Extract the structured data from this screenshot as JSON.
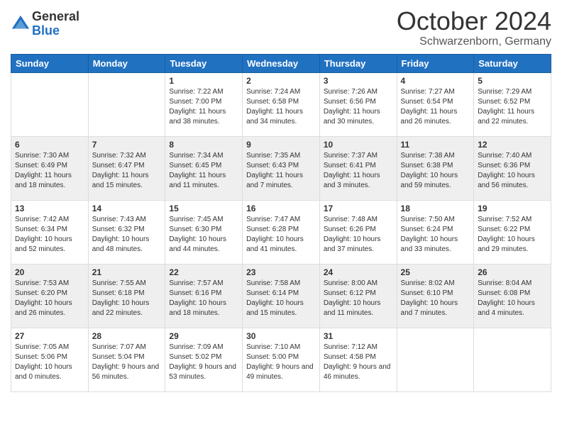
{
  "header": {
    "logo": {
      "general": "General",
      "blue": "Blue"
    },
    "title": "October 2024",
    "location": "Schwarzenborn, Germany"
  },
  "calendar": {
    "weekdays": [
      "Sunday",
      "Monday",
      "Tuesday",
      "Wednesday",
      "Thursday",
      "Friday",
      "Saturday"
    ],
    "weeks": [
      [
        {
          "day": null,
          "sunrise": null,
          "sunset": null,
          "daylight": null
        },
        {
          "day": null,
          "sunrise": null,
          "sunset": null,
          "daylight": null
        },
        {
          "day": "1",
          "sunrise": "Sunrise: 7:22 AM",
          "sunset": "Sunset: 7:00 PM",
          "daylight": "Daylight: 11 hours and 38 minutes."
        },
        {
          "day": "2",
          "sunrise": "Sunrise: 7:24 AM",
          "sunset": "Sunset: 6:58 PM",
          "daylight": "Daylight: 11 hours and 34 minutes."
        },
        {
          "day": "3",
          "sunrise": "Sunrise: 7:26 AM",
          "sunset": "Sunset: 6:56 PM",
          "daylight": "Daylight: 11 hours and 30 minutes."
        },
        {
          "day": "4",
          "sunrise": "Sunrise: 7:27 AM",
          "sunset": "Sunset: 6:54 PM",
          "daylight": "Daylight: 11 hours and 26 minutes."
        },
        {
          "day": "5",
          "sunrise": "Sunrise: 7:29 AM",
          "sunset": "Sunset: 6:52 PM",
          "daylight": "Daylight: 11 hours and 22 minutes."
        }
      ],
      [
        {
          "day": "6",
          "sunrise": "Sunrise: 7:30 AM",
          "sunset": "Sunset: 6:49 PM",
          "daylight": "Daylight: 11 hours and 18 minutes."
        },
        {
          "day": "7",
          "sunrise": "Sunrise: 7:32 AM",
          "sunset": "Sunset: 6:47 PM",
          "daylight": "Daylight: 11 hours and 15 minutes."
        },
        {
          "day": "8",
          "sunrise": "Sunrise: 7:34 AM",
          "sunset": "Sunset: 6:45 PM",
          "daylight": "Daylight: 11 hours and 11 minutes."
        },
        {
          "day": "9",
          "sunrise": "Sunrise: 7:35 AM",
          "sunset": "Sunset: 6:43 PM",
          "daylight": "Daylight: 11 hours and 7 minutes."
        },
        {
          "day": "10",
          "sunrise": "Sunrise: 7:37 AM",
          "sunset": "Sunset: 6:41 PM",
          "daylight": "Daylight: 11 hours and 3 minutes."
        },
        {
          "day": "11",
          "sunrise": "Sunrise: 7:38 AM",
          "sunset": "Sunset: 6:38 PM",
          "daylight": "Daylight: 10 hours and 59 minutes."
        },
        {
          "day": "12",
          "sunrise": "Sunrise: 7:40 AM",
          "sunset": "Sunset: 6:36 PM",
          "daylight": "Daylight: 10 hours and 56 minutes."
        }
      ],
      [
        {
          "day": "13",
          "sunrise": "Sunrise: 7:42 AM",
          "sunset": "Sunset: 6:34 PM",
          "daylight": "Daylight: 10 hours and 52 minutes."
        },
        {
          "day": "14",
          "sunrise": "Sunrise: 7:43 AM",
          "sunset": "Sunset: 6:32 PM",
          "daylight": "Daylight: 10 hours and 48 minutes."
        },
        {
          "day": "15",
          "sunrise": "Sunrise: 7:45 AM",
          "sunset": "Sunset: 6:30 PM",
          "daylight": "Daylight: 10 hours and 44 minutes."
        },
        {
          "day": "16",
          "sunrise": "Sunrise: 7:47 AM",
          "sunset": "Sunset: 6:28 PM",
          "daylight": "Daylight: 10 hours and 41 minutes."
        },
        {
          "day": "17",
          "sunrise": "Sunrise: 7:48 AM",
          "sunset": "Sunset: 6:26 PM",
          "daylight": "Daylight: 10 hours and 37 minutes."
        },
        {
          "day": "18",
          "sunrise": "Sunrise: 7:50 AM",
          "sunset": "Sunset: 6:24 PM",
          "daylight": "Daylight: 10 hours and 33 minutes."
        },
        {
          "day": "19",
          "sunrise": "Sunrise: 7:52 AM",
          "sunset": "Sunset: 6:22 PM",
          "daylight": "Daylight: 10 hours and 29 minutes."
        }
      ],
      [
        {
          "day": "20",
          "sunrise": "Sunrise: 7:53 AM",
          "sunset": "Sunset: 6:20 PM",
          "daylight": "Daylight: 10 hours and 26 minutes."
        },
        {
          "day": "21",
          "sunrise": "Sunrise: 7:55 AM",
          "sunset": "Sunset: 6:18 PM",
          "daylight": "Daylight: 10 hours and 22 minutes."
        },
        {
          "day": "22",
          "sunrise": "Sunrise: 7:57 AM",
          "sunset": "Sunset: 6:16 PM",
          "daylight": "Daylight: 10 hours and 18 minutes."
        },
        {
          "day": "23",
          "sunrise": "Sunrise: 7:58 AM",
          "sunset": "Sunset: 6:14 PM",
          "daylight": "Daylight: 10 hours and 15 minutes."
        },
        {
          "day": "24",
          "sunrise": "Sunrise: 8:00 AM",
          "sunset": "Sunset: 6:12 PM",
          "daylight": "Daylight: 10 hours and 11 minutes."
        },
        {
          "day": "25",
          "sunrise": "Sunrise: 8:02 AM",
          "sunset": "Sunset: 6:10 PM",
          "daylight": "Daylight: 10 hours and 7 minutes."
        },
        {
          "day": "26",
          "sunrise": "Sunrise: 8:04 AM",
          "sunset": "Sunset: 6:08 PM",
          "daylight": "Daylight: 10 hours and 4 minutes."
        }
      ],
      [
        {
          "day": "27",
          "sunrise": "Sunrise: 7:05 AM",
          "sunset": "Sunset: 5:06 PM",
          "daylight": "Daylight: 10 hours and 0 minutes."
        },
        {
          "day": "28",
          "sunrise": "Sunrise: 7:07 AM",
          "sunset": "Sunset: 5:04 PM",
          "daylight": "Daylight: 9 hours and 56 minutes."
        },
        {
          "day": "29",
          "sunrise": "Sunrise: 7:09 AM",
          "sunset": "Sunset: 5:02 PM",
          "daylight": "Daylight: 9 hours and 53 minutes."
        },
        {
          "day": "30",
          "sunrise": "Sunrise: 7:10 AM",
          "sunset": "Sunset: 5:00 PM",
          "daylight": "Daylight: 9 hours and 49 minutes."
        },
        {
          "day": "31",
          "sunrise": "Sunrise: 7:12 AM",
          "sunset": "Sunset: 4:58 PM",
          "daylight": "Daylight: 9 hours and 46 minutes."
        },
        {
          "day": null,
          "sunrise": null,
          "sunset": null,
          "daylight": null
        },
        {
          "day": null,
          "sunrise": null,
          "sunset": null,
          "daylight": null
        }
      ]
    ]
  }
}
